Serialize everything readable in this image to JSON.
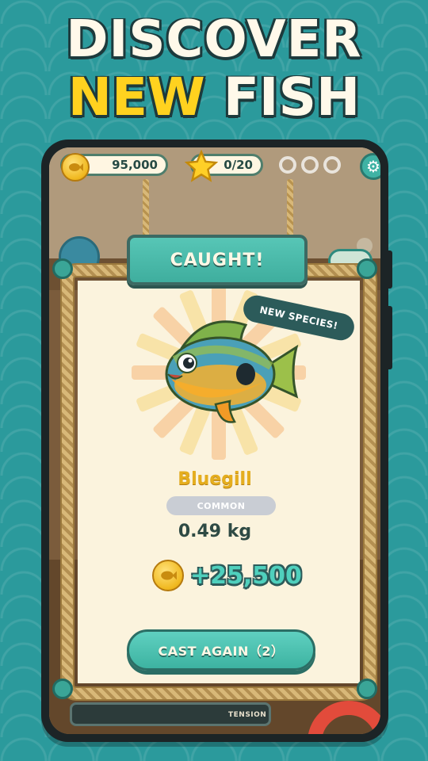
{
  "headline": {
    "line1": "DISCOVER",
    "line2_highlight": "NEW",
    "line2_rest": "FISH"
  },
  "hud": {
    "coins": "95,000",
    "stars": "0/20"
  },
  "modal": {
    "sign_title": "CAUGHT!",
    "badge": "NEW SPECIES!",
    "fish_name": "Bluegill",
    "rarity": "COMMON",
    "weight": "0.49 kg",
    "reward": "+25,500",
    "cast_button": "CAST AGAIN（2）"
  },
  "scene": {
    "tension_label": "TENSION"
  },
  "colors": {
    "background": "#2b9a9c",
    "headline_yellow": "#ffd21f",
    "accent_teal": "#3fae9e",
    "fish_name_gold": "#e5ae1e"
  }
}
